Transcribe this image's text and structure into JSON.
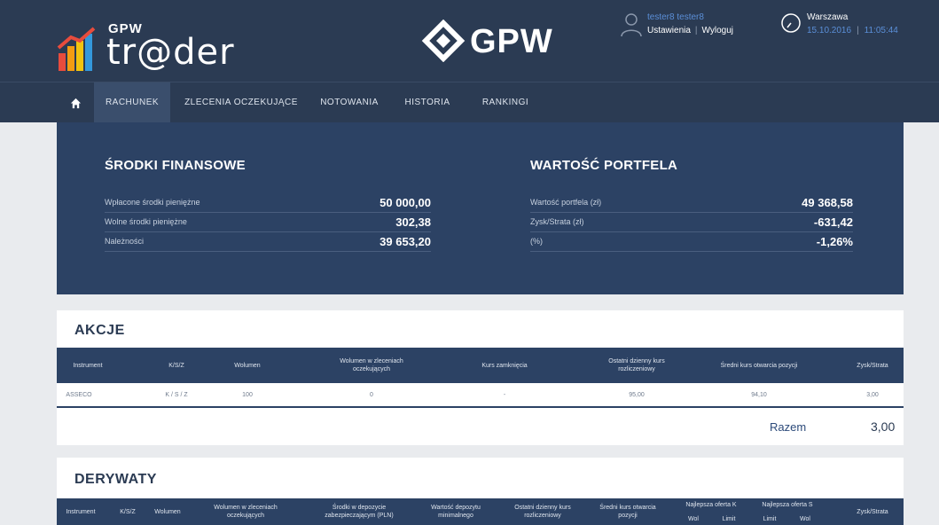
{
  "brand": {
    "app_small": "GPW",
    "app_name": "tr@der",
    "center_logo": "GPW"
  },
  "user": {
    "name": "tester8 tester8",
    "settings": "Ustawienia",
    "logout": "Wyloguj"
  },
  "clock": {
    "city": "Warszawa",
    "date": "15.10.2016",
    "time": "11:05:44"
  },
  "nav": {
    "items": [
      "RACHUNEK",
      "ZLECENIA OCZEKUJĄCE",
      "NOTOWANIA",
      "HISTORIA",
      "RANKINGI"
    ],
    "active": "RACHUNEK"
  },
  "finance": {
    "left_title": "ŚRODKI FINANSOWE",
    "left_rows": [
      {
        "label": "Wpłacone środki pieniężne",
        "value": "50 000,00"
      },
      {
        "label": "Wolne środki pieniężne",
        "value": "302,38"
      },
      {
        "label": "Należności",
        "value": "39 653,20"
      }
    ],
    "right_title": "WARTOŚĆ PORTFELA",
    "right_rows": [
      {
        "label": "Wartość portfela (zł)",
        "value": "49 368,58"
      },
      {
        "label": "Zysk/Strata (zł)",
        "value": "-631,42"
      },
      {
        "label": "(%)",
        "value": "-1,26%"
      }
    ]
  },
  "akcje": {
    "title": "AKCJE",
    "headers": [
      "Instrument",
      "K/S/Z",
      "Wolumen",
      "Wolumen w zleceniach oczekujących",
      "Kurs zamknięcia",
      "Ostatni dzienny kurs rozliczeniowy",
      "Średni kurs otwarcia pozycji",
      "Zysk/Strata"
    ],
    "rows": [
      [
        "ASSECO",
        "K / S / Z",
        "100",
        "0",
        "-",
        "95,00",
        "94,10",
        "3,00"
      ]
    ],
    "total_label": "Razem",
    "total_value": "3,00"
  },
  "derywaty": {
    "title": "DERYWATY",
    "headers": [
      "Instrument",
      "K/S/Z",
      "Wolumen",
      "Wolumen w zleceniach oczekujących",
      "Środki w depozycie zabezpieczającym (PLN)",
      "Wartość depozytu minimalnego",
      "Ostatni dzienny kurs rozliczeniowy",
      "Średni kurs otwarcia pozycji",
      "Najlepsza oferta K",
      "Najlepsza oferta S",
      "Zysk/Strata"
    ],
    "sub_headers": {
      "k": [
        "Wol",
        "Limit"
      ],
      "s": [
        "Limit",
        "Wol"
      ]
    }
  },
  "colors": {
    "header": "#2b3b53",
    "panel": "#2c4264",
    "accent": "#5b8fd8"
  }
}
